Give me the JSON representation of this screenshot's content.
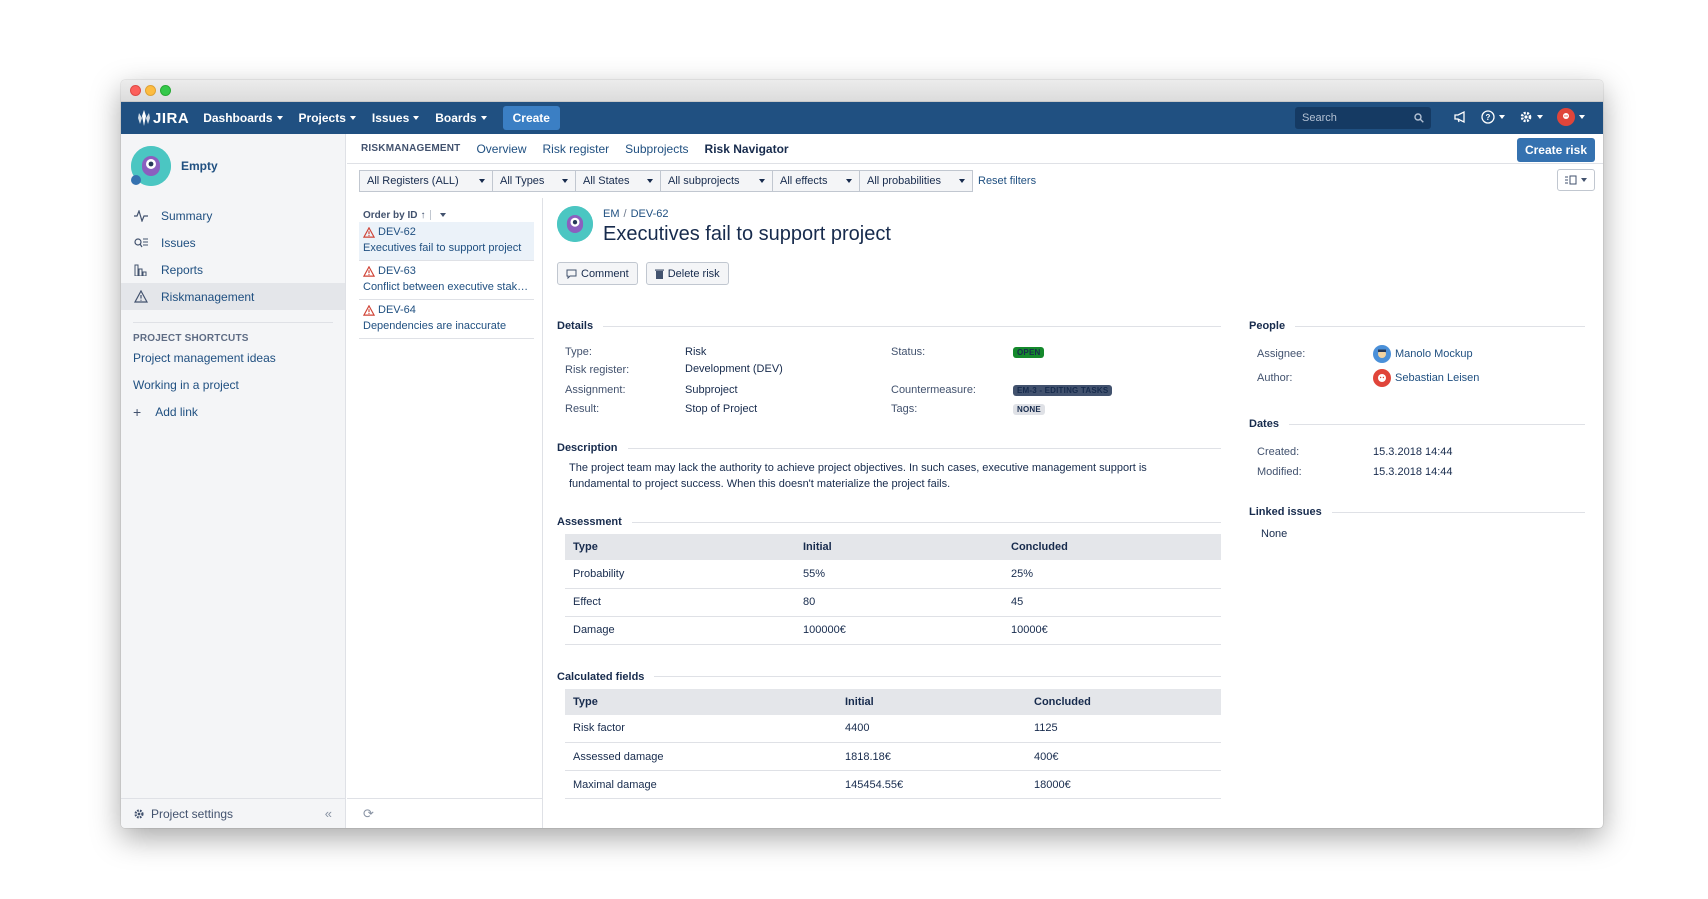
{
  "topnav": {
    "logo": "JIRA",
    "items": [
      "Dashboards",
      "Projects",
      "Issues",
      "Boards"
    ],
    "create": "Create",
    "search_placeholder": "Search"
  },
  "sidebar": {
    "project_name": "Empty",
    "nav": [
      {
        "label": "Summary",
        "icon": "pulse-icon"
      },
      {
        "label": "Issues",
        "icon": "issues-icon"
      },
      {
        "label": "Reports",
        "icon": "reports-icon"
      },
      {
        "label": "Riskmanagement",
        "icon": "warning-icon"
      }
    ],
    "shortcuts_title": "PROJECT SHORTCUTS",
    "shortcuts": [
      "Project management ideas",
      "Working in a project"
    ],
    "add_link": "Add link",
    "settings": "Project settings"
  },
  "subnav": {
    "section": "RISKMANAGEMENT",
    "links": [
      "Overview",
      "Risk register",
      "Subprojects"
    ],
    "current": "Risk Navigator",
    "create_risk": "Create risk"
  },
  "filters": {
    "items": [
      "All Registers (ALL)",
      "All Types",
      "All States",
      "All subprojects",
      "All effects",
      "All probabilities"
    ],
    "reset": "Reset filters"
  },
  "list": {
    "order_label": "Order by ID",
    "items": [
      {
        "id": "DEV-62",
        "summary": "Executives fail to support project"
      },
      {
        "id": "DEV-63",
        "summary": "Conflict between executive stake..."
      },
      {
        "id": "DEV-64",
        "summary": "Dependencies are inaccurate"
      }
    ]
  },
  "detail": {
    "crumb_project": "EM",
    "crumb_issue": "DEV-62",
    "title": "Executives fail to support project",
    "actions": {
      "comment": "Comment",
      "delete": "Delete risk"
    },
    "details_title": "Details",
    "fields": {
      "type_k": "Type:",
      "type_v": "Risk",
      "register_k": "Risk register:",
      "register_v": "Development (DEV)",
      "assignment_k": "Assignment:",
      "assignment_v": "Subproject",
      "result_k": "Result:",
      "result_v": "Stop of Project",
      "status_k": "Status:",
      "status_v": "OPEN",
      "counter_k": "Countermeasure:",
      "counter_v": "EM-3 - EDITING TASKS",
      "tags_k": "Tags:",
      "tags_v": "NONE"
    },
    "description_title": "Description",
    "description": "The project team may lack the authority to achieve project objectives. In such cases, executive management support is fundamental to project success. When this doesn't materialize the project fails.",
    "assessment": {
      "title": "Assessment",
      "headers": [
        "Type",
        "Initial",
        "Concluded"
      ],
      "rows": [
        [
          "Probability",
          "55%",
          "25%"
        ],
        [
          "Effect",
          "80",
          "45"
        ],
        [
          "Damage",
          "100000€",
          "10000€"
        ]
      ]
    },
    "calculated": {
      "title": "Calculated fields",
      "headers": [
        "Type",
        "Initial",
        "Concluded"
      ],
      "rows": [
        [
          "Risk factor",
          "4400",
          "1125"
        ],
        [
          "Assessed damage",
          "1818.18€",
          "400€"
        ],
        [
          "Maximal damage",
          "145454.55€",
          "18000€"
        ]
      ]
    },
    "people": {
      "title": "People",
      "assignee_k": "Assignee:",
      "assignee_v": "Manolo Mockup",
      "author_k": "Author:",
      "author_v": "Sebastian Leisen"
    },
    "dates": {
      "title": "Dates",
      "created_k": "Created:",
      "created_v": "15.3.2018 14:44",
      "modified_k": "Modified:",
      "modified_v": "15.3.2018 14:44"
    },
    "linked": {
      "title": "Linked issues",
      "value": "None"
    }
  },
  "colors": {
    "nav": "#205081",
    "accent": "#3572b0",
    "open": "#14892c",
    "warning": "#d04437"
  }
}
